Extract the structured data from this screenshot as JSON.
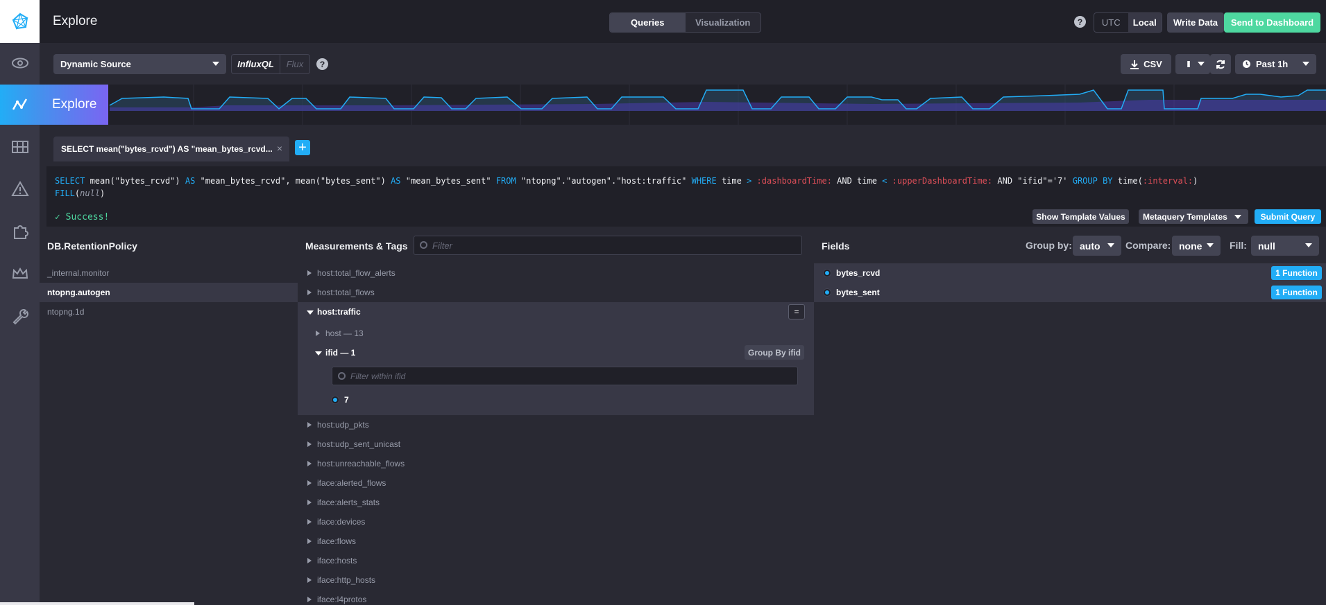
{
  "header": {
    "title": "Explore",
    "mode_tabs": [
      "Queries",
      "Visualization"
    ],
    "timezone": [
      "UTC",
      "Local"
    ],
    "write_data": "Write Data",
    "send_to_dashboard": "Send to Dashboard",
    "help": "?"
  },
  "sidebar": {
    "flyout_label": "Explore",
    "icons": [
      "logo-icon",
      "eye-icon",
      "graph-icon",
      "grid-icon",
      "alert-icon",
      "puzzle-icon",
      "crown-icon",
      "wrench-icon"
    ]
  },
  "toolbar": {
    "source": "Dynamic Source",
    "lang_on": "InfluxQL",
    "lang_off": "Flux",
    "help": "?",
    "csv": "CSV",
    "pause": "II",
    "time_range": "Past 1h"
  },
  "query": {
    "tab_label": "SELECT mean(\"bytes_rcvd\") AS \"mean_bytes_rcvd...",
    "tab_close": "×",
    "add": "+",
    "status": "✓ Success!",
    "show_template_values": "Show Template Values",
    "metaquery_templates": "Metaquery Templates",
    "submit": "Submit Query",
    "parts": {
      "select": "SELECT",
      "s1": " mean(\"bytes_rcvd\") ",
      "as1": "AS",
      "s2": " \"mean_bytes_rcvd\", mean(\"bytes_sent\") ",
      "as2": "AS",
      "s3": " \"mean_bytes_sent\" ",
      "from": "FROM",
      "s4": " \"ntopng\".\"autogen\".\"host:traffic\" ",
      "where": "WHERE",
      "s5": " time ",
      "gt": ">",
      "s6": " ",
      "dash": ":dashboardTime:",
      "s7": " AND time ",
      "lt": "<",
      "s8": " ",
      "upper": ":upperDashboardTime:",
      "s9": " AND \"ifid\"='7' ",
      "groupby": "GROUP BY",
      "s10": " time(",
      "interval": ":interval:",
      "s11": ")",
      "fill": "FILL",
      "s12": "(",
      "null": "null",
      "s13": ")"
    }
  },
  "columns": {
    "db_title": "DB.RetentionPolicy",
    "meas_title": "Measurements & Tags",
    "filter_placeholder": "Filter",
    "fields_title": "Fields",
    "group_by_label": "Group by:",
    "group_by_value": "auto",
    "compare_label": "Compare:",
    "compare_value": "none",
    "fill_label": "Fill:",
    "fill_value": "null"
  },
  "databases": [
    "_internal.monitor",
    "ntopng.autogen",
    "ntopng.1d"
  ],
  "measurements_top": [
    "host:total_flow_alerts",
    "host:total_flows"
  ],
  "expanded": {
    "name": "host:traffic",
    "eq": "=",
    "tag1": "host — 13",
    "tag2": "ifid — 1",
    "group_by": "Group By ifid",
    "tag_filter": "Filter within ifid",
    "value": "7"
  },
  "measurements_bottom": [
    "host:udp_pkts",
    "host:udp_sent_unicast",
    "host:unreachable_flows",
    "iface:alerted_flows",
    "iface:alerts_stats",
    "iface:devices",
    "iface:flows",
    "iface:hosts",
    "iface:http_hosts",
    "iface:l4protos"
  ],
  "fields": [
    "bytes_rcvd",
    "bytes_sent"
  ],
  "function_label": "1 Function"
}
